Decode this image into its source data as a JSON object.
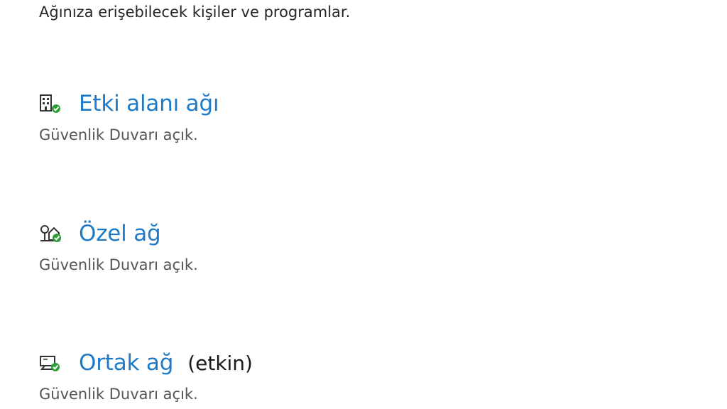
{
  "intro_text": "Ağınıza erişebilecek kişiler ve programlar.",
  "colors": {
    "link": "#1e7ac7",
    "check": "#2e9e3a",
    "icon_stroke": "#333333"
  },
  "networks": [
    {
      "icon": "domain-network-icon",
      "label": "Etki alanı ağı",
      "status": "Güvenlik Duvarı açık."
    },
    {
      "icon": "private-network-icon",
      "label": "Özel ağ",
      "status": "Güvenlik Duvarı açık."
    },
    {
      "icon": "public-network-icon",
      "label": "Ortak ağ",
      "active": "(etkin)",
      "status": "Güvenlik Duvarı açık."
    }
  ]
}
